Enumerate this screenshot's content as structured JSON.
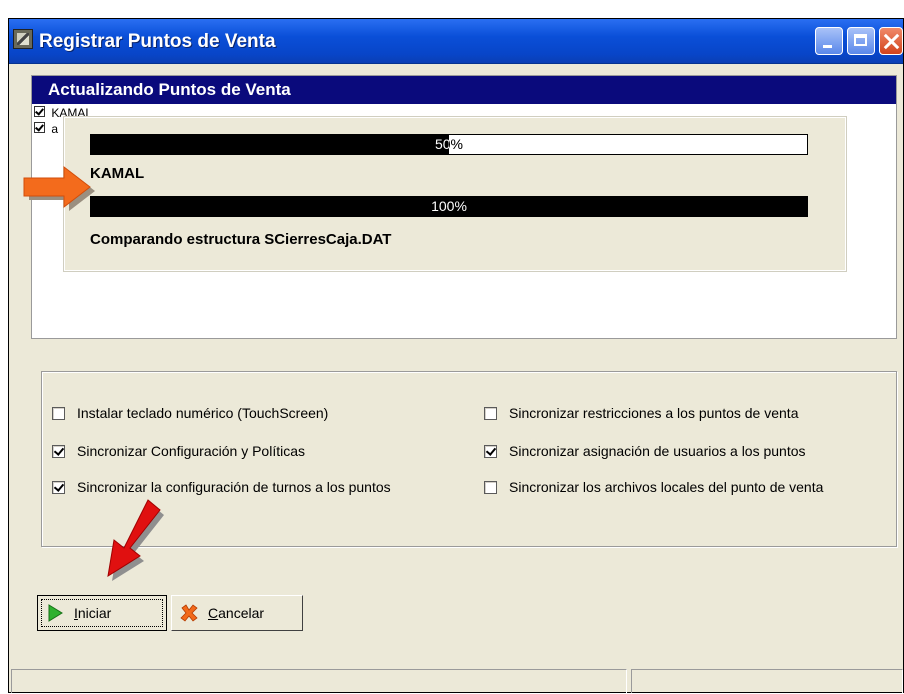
{
  "window": {
    "title": "Registrar Puntos de Venta"
  },
  "list": {
    "header": "Actualizando Puntos de Venta",
    "items": [
      {
        "label": "KAMAL",
        "checked": true
      },
      {
        "label": "a",
        "checked": true
      }
    ]
  },
  "progress": {
    "bar1": {
      "percent_text": "50%",
      "value": 0.5
    },
    "bar1_label": "KAMAL",
    "bar2": {
      "percent_text": "100%",
      "value": 1.0
    },
    "bar2_label": "Comparando estructura SCierresCaja.DAT"
  },
  "options": {
    "left": [
      {
        "label": "Instalar teclado numérico (TouchScreen)",
        "checked": false
      },
      {
        "label": "Sincronizar Configuración y Políticas",
        "checked": true
      },
      {
        "label": "Sincronizar la configuración de turnos a los puntos",
        "checked": true
      }
    ],
    "right": [
      {
        "label": "Sincronizar restricciones a los puntos de venta",
        "checked": false
      },
      {
        "label": "Sincronizar asignación de usuarios a los puntos",
        "checked": true
      },
      {
        "label": "Sincronizar los archivos locales del punto de venta",
        "checked": false
      }
    ]
  },
  "buttons": {
    "iniciar": {
      "mnemonic": "I",
      "rest": "niciar"
    },
    "cancelar": {
      "mnemonic": "C",
      "rest": "ancelar"
    }
  },
  "colors": {
    "list_header_bg": "#0a0a7c",
    "arrow_orange": "#f36b1c",
    "arrow_red": "#e01010"
  }
}
